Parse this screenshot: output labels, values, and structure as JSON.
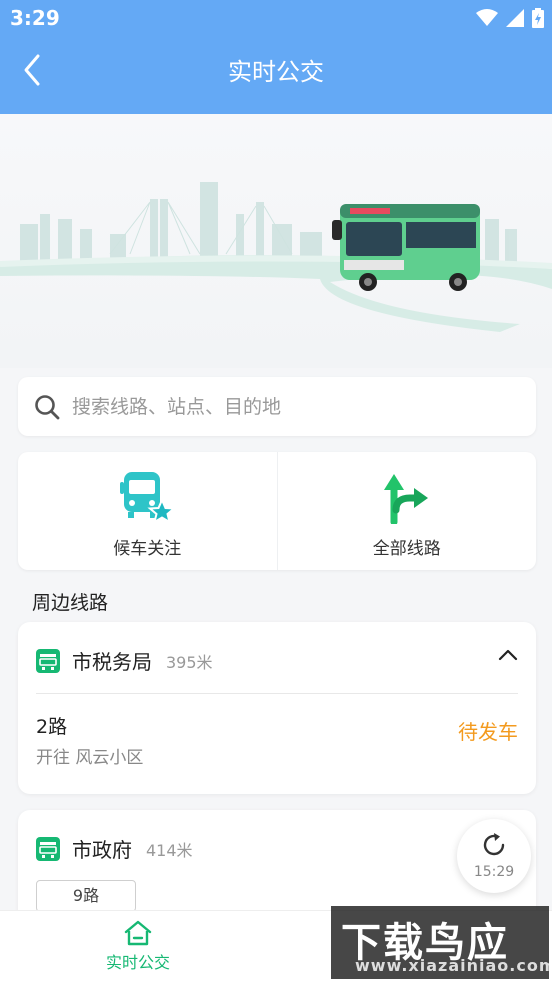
{
  "status_bar": {
    "time": "3:29"
  },
  "header": {
    "title": "实时公交"
  },
  "search": {
    "placeholder": "搜索线路、站点、目的地"
  },
  "quick_actions": [
    {
      "label": "候车关注",
      "icon": "bus-star-icon"
    },
    {
      "label": "全部线路",
      "icon": "route-arrows-icon"
    }
  ],
  "nearby": {
    "title": "周边线路",
    "stations": [
      {
        "name": "市税务局",
        "distance": "395米",
        "routes": [
          {
            "name": "2路",
            "direction": "开往 风云小区",
            "status": "待发车"
          }
        ]
      },
      {
        "name": "市政府",
        "distance": "414米",
        "routes": [
          {
            "name": "9路"
          }
        ]
      }
    ]
  },
  "refresh": {
    "time": "15:29"
  },
  "bottom_nav": {
    "items": [
      {
        "label": "实时公交",
        "active": true
      }
    ]
  },
  "watermark": {
    "main": "下载鸟应用",
    "sub": "www.xiazainiao.com"
  },
  "colors": {
    "header_blue": "#64a9f5",
    "accent_green": "#16b873",
    "status_orange": "#f39a1e",
    "bus_green": "#5fcf8f"
  }
}
